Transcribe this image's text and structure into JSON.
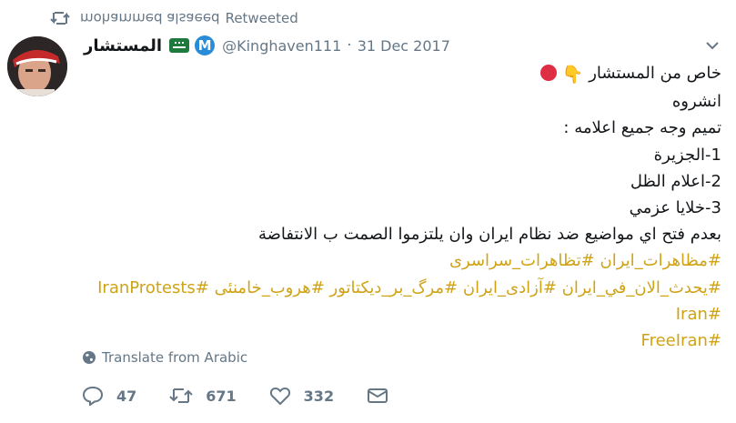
{
  "retweet": {
    "user": "mohammed alsaeed",
    "label": "Retweeted"
  },
  "author": {
    "display_name": "المستشار",
    "handle": "@Kinghaven111",
    "date": "31 Dec 2017",
    "badge_letter": "M"
  },
  "tweet": {
    "line1": "خاص من المستشار",
    "line2": "انشروه",
    "line3": "تميم وجه جميع اعلامه :",
    "line4": "1-الجزيرة",
    "line5": "2-اعلام الظل",
    "line6": "3-خلايا عزمي",
    "line7": "بعدم فتح اي مواضيع ضد نظام ايران وان يلتزموا الصمت ب الانتفاضة",
    "hashtags_line1": "#مظاهرات_ایران #تظاهرات_سراسری",
    "hashtags_line2": "#يحدث_الان_في_ايران #آزادی_ایران #مرگ_بر_دیکتاتور #هروب_خامنئی #IranProtests",
    "hashtags_line3": "#Iran",
    "hashtags_line4": "#FreeIran"
  },
  "translate_label": "Translate from Arabic",
  "actions": {
    "reply_count": "47",
    "retweet_count": "671",
    "like_count": "332"
  },
  "colors": {
    "hashtag": "#cfa315",
    "muted": "#657786",
    "text": "#14171a"
  },
  "icons": [
    "retweet-icon",
    "saudi-flag-icon",
    "verified-m-icon",
    "chevron-down-icon",
    "red-circle-icon",
    "pointing-down-icon",
    "globe-icon",
    "reply-icon",
    "like-icon",
    "message-icon"
  ]
}
